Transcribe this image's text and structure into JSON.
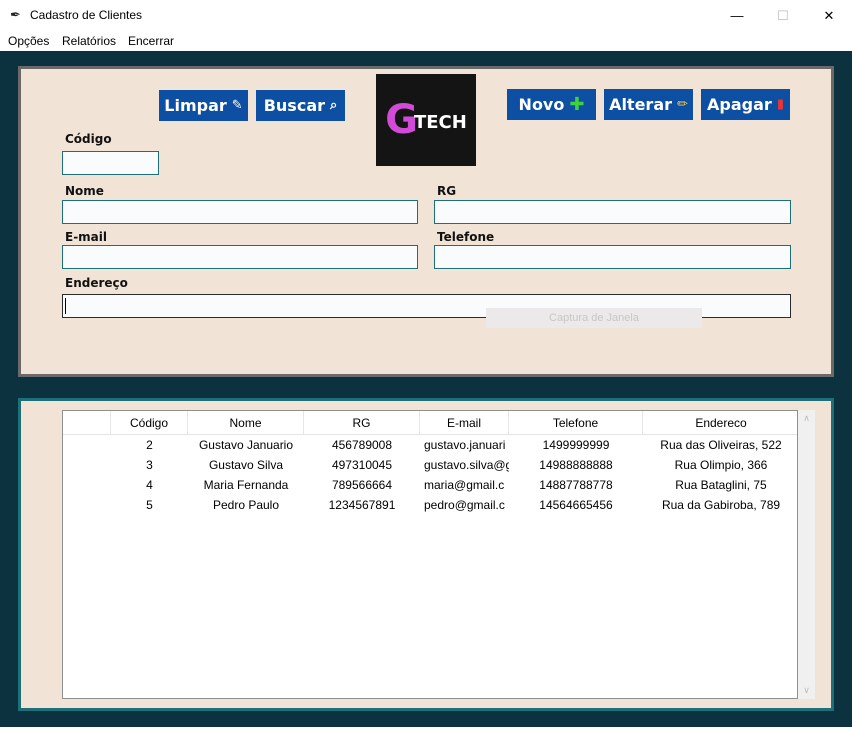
{
  "window": {
    "title": "Cadastro de Clientes",
    "icon": "feather-icon",
    "controls": {
      "minimize": "—",
      "maximize": "☐",
      "close": "✕"
    }
  },
  "menu": [
    "Opções",
    "Relatórios",
    "Encerrar"
  ],
  "toolbar": {
    "limpar": {
      "label": "Limpar",
      "icon": "eraser-icon"
    },
    "buscar": {
      "label": "Buscar",
      "icon": "magnifier-icon"
    },
    "novo": {
      "label": "Novo",
      "icon": "plus-icon"
    },
    "alterar": {
      "label": "Alterar",
      "icon": "pencil-icon"
    },
    "apagar": {
      "label": "Apagar",
      "icon": "trash-icon"
    }
  },
  "logo": {
    "mark": "G",
    "text": "TECH"
  },
  "form": {
    "codigo": {
      "label": "Código",
      "value": ""
    },
    "nome": {
      "label": "Nome",
      "value": ""
    },
    "rg": {
      "label": "RG",
      "value": ""
    },
    "email": {
      "label": "E-mail",
      "value": ""
    },
    "telefone": {
      "label": "Telefone",
      "value": ""
    },
    "endereco": {
      "label": "Endereço",
      "value": ""
    }
  },
  "overlay_ghost": "Captura de Janela",
  "table": {
    "columns": [
      "",
      "Código",
      "Nome",
      "RG",
      "E-mail",
      "Telefone",
      "Endereco"
    ],
    "rows": [
      [
        "2",
        "Gustavo Januario",
        "456789008",
        "gustavo.januari",
        "1499999999",
        "Rua das Oliveiras, 522"
      ],
      [
        "3",
        "Gustavo Silva",
        "497310045",
        "gustavo.silva@g",
        "14988888888",
        "Rua Olimpio, 366"
      ],
      [
        "4",
        "Maria Fernanda",
        "789566664",
        "maria@gmail.c",
        "14887788778",
        "Rua Bataglini, 75"
      ],
      [
        "5",
        "Pedro Paulo",
        "1234567891",
        "pedro@gmail.c",
        "14564665456",
        "Rua da Gabiroba, 789"
      ]
    ]
  },
  "colors": {
    "background": "#0c3240",
    "panel": "#f2e3d7",
    "button": "#0d4fa3",
    "field_border": "#1f6f78"
  }
}
